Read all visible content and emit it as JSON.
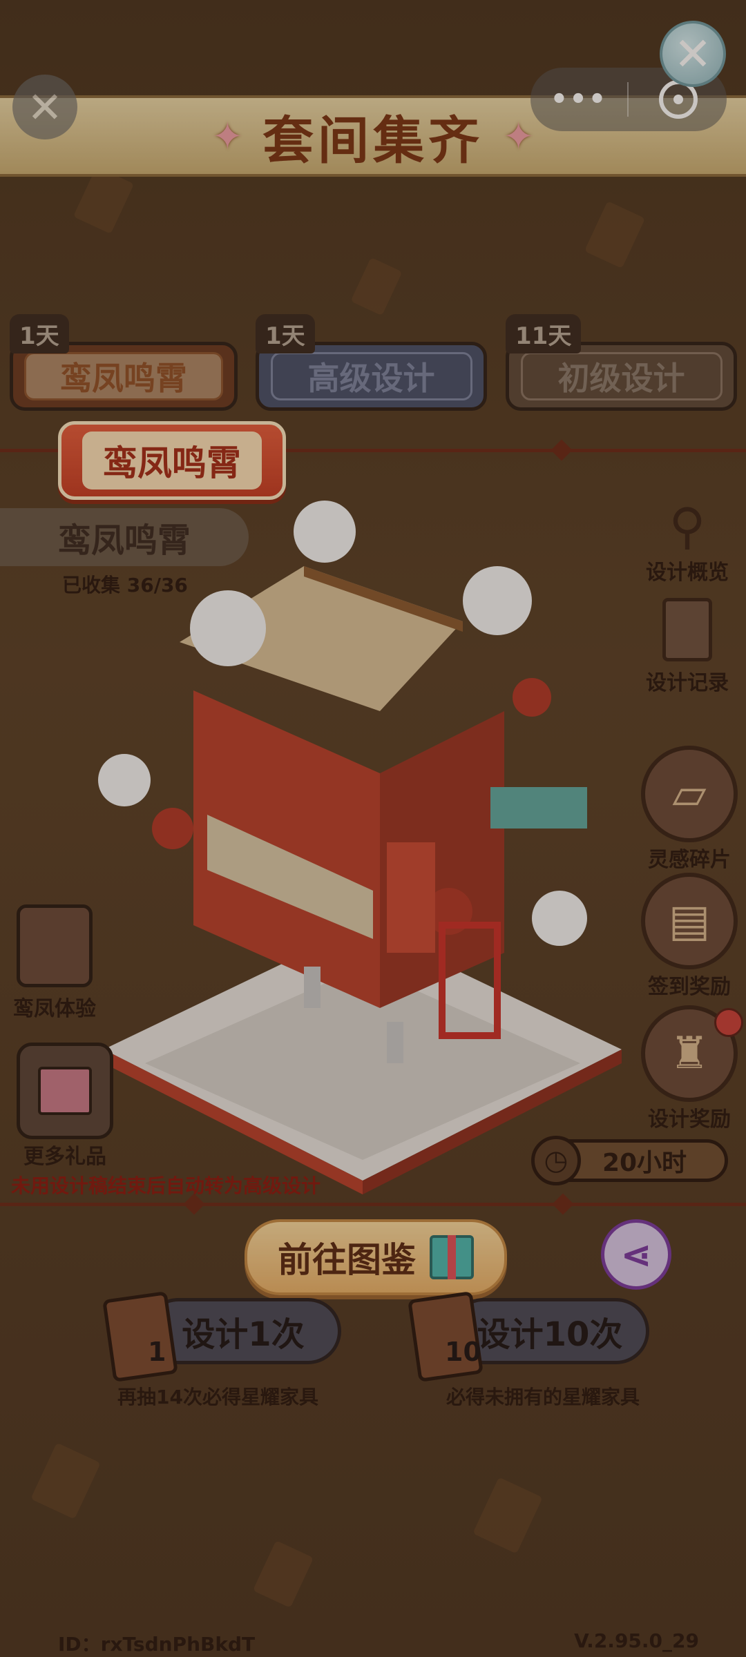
{
  "header": {
    "title": "套间集齐",
    "sparkle": "✦",
    "menu_dots": "•••"
  },
  "tabs": [
    {
      "label": "鸾凤鸣霄",
      "days": "1天"
    },
    {
      "label": "高级设计",
      "days": "1天"
    },
    {
      "label": "初级设计",
      "days": "11天"
    }
  ],
  "selected_set": {
    "badge": "鸾凤鸣霄",
    "name": "鸾凤鸣霄",
    "collected": "已收集 36/36"
  },
  "right_menu": [
    {
      "label": "设计概览",
      "icon": "magnifier-icon"
    },
    {
      "label": "设计记录",
      "icon": "clipboard-icon"
    },
    {
      "label": "灵感碎片",
      "icon": "map-icon"
    },
    {
      "label": "签到奖励",
      "icon": "calendar-icon"
    },
    {
      "label": "设计奖励",
      "icon": "lantern-icon"
    }
  ],
  "left_menu": [
    {
      "label": "鸾凤体验",
      "icon": "scroll-icon"
    },
    {
      "label": "更多礼品",
      "icon": "gift-icon"
    }
  ],
  "timer": "20小时",
  "notice": "未用设计稿结束后自动转为高级设计",
  "gallery_button": "前往图鉴",
  "draw_buttons": [
    {
      "label": "设计1次",
      "count": "1",
      "note": "再抽14次必得星耀家具"
    },
    {
      "label": "设计10次",
      "count": "10",
      "note": "必得未拥有的星耀家具"
    }
  ],
  "footer": {
    "id": "ID：rxTsdnPhBkdT",
    "version": "V.2.95.0_29"
  }
}
